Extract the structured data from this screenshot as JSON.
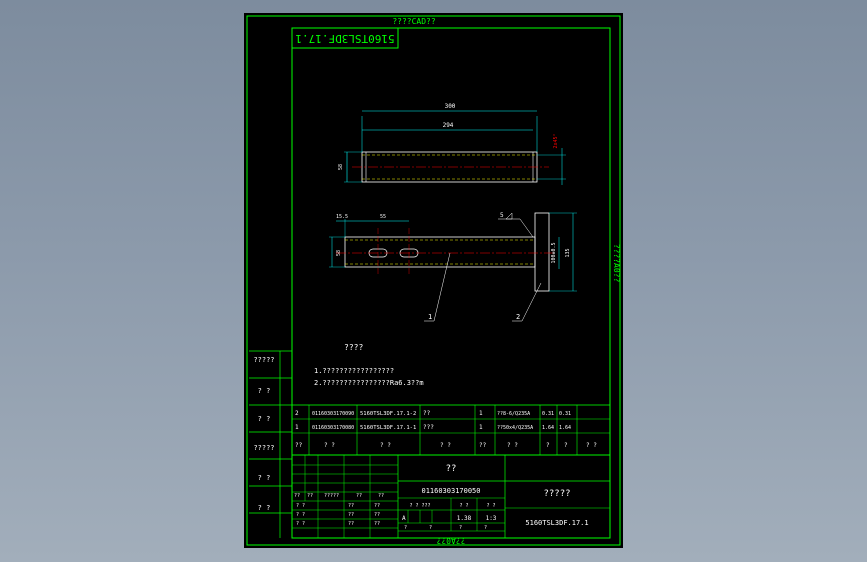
{
  "header": {
    "top_title": "????CAD??",
    "bottom_title": "??A0??",
    "side_title": "????A0??",
    "drawing_no_stamp": "5160TSL3DF.17.1"
  },
  "dimensions": {
    "top_view": {
      "overall": "300",
      "inner": "294",
      "height": "58",
      "chamfer": "2x45°"
    },
    "bottom_view": {
      "left_offset": "15.5",
      "slot_pitch": "55",
      "height": "58",
      "flange_width": "100±0.5",
      "flange_height": "135",
      "weld": "5"
    }
  },
  "callouts": [
    "1",
    "2"
  ],
  "notes": {
    "title": "????",
    "line1": "1.?????????????????",
    "line2": "2.????????????????Ra6.3??m"
  },
  "left_column_labels": [
    "?????",
    "? ?",
    "? ?",
    "?????",
    "? ?",
    "? ?"
  ],
  "bom": {
    "rows": [
      [
        "2",
        "01160303170090",
        "5160TSL3DF.17.1-2",
        "??",
        "1",
        "??8-6/Q235A",
        "0.31",
        "0.31",
        ""
      ],
      [
        "1",
        "01160303170080",
        "5160TSL3DF.17.1-1",
        "???",
        "1",
        "??50x4/Q235A",
        "1.64",
        "1.64",
        ""
      ]
    ],
    "header": [
      "??",
      "?  ?",
      "?  ?",
      "?  ?",
      "??",
      "?  ?",
      "?",
      "?",
      "?  ?"
    ]
  },
  "title_block": {
    "name": "??",
    "code": "01160303170050",
    "company": "?????",
    "drawing_no": "5160TSL3DF.17.1",
    "stage_mark": "A",
    "scale": "1:3",
    "weight": "1.38",
    "rev_header": [
      "??",
      "??",
      "?????",
      "??",
      "??"
    ],
    "rev_rows": [
      [
        "?  ?",
        "",
        "",
        "??",
        "??"
      ],
      [
        "? ?",
        "",
        "",
        "??",
        "??"
      ],
      [
        "? ?",
        "",
        "",
        "??",
        "??"
      ]
    ],
    "stage_labels": [
      "?  ?",
      "???",
      "?  ?",
      "?  ?"
    ],
    "sheet_info": [
      "?",
      "?",
      "?",
      "?"
    ]
  },
  "colors": {
    "frame": "#00ff00",
    "dimension": "#00ffff",
    "center_line": "#ff0000",
    "object": "#ffff00",
    "text": "#ffffff"
  }
}
